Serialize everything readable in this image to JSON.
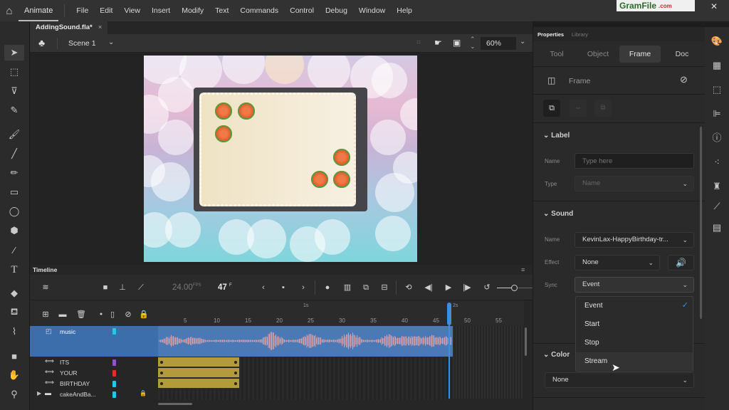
{
  "menubar": {
    "app_name": "Animate",
    "items": [
      "File",
      "Edit",
      "View",
      "Insert",
      "Modify",
      "Text",
      "Commands",
      "Control",
      "Debug",
      "Window",
      "Help"
    ],
    "watermark": "GramFile",
    "watermark_suffix": ".com"
  },
  "document": {
    "tab_label": "AddingSound.fla*",
    "close_glyph": "×",
    "scene_label": "Scene 1",
    "zoom_value": "60%"
  },
  "tools": [
    "selection",
    "subselection",
    "free-transform",
    "lasso",
    "puppet-pin",
    "paint-brush",
    "brush",
    "pencil",
    "rectangle",
    "oval",
    "polystar",
    "line",
    "text",
    "eraser",
    "paint-bucket",
    "eyedropper",
    "camera",
    "hand",
    "zoom"
  ],
  "timeline": {
    "title": "Timeline",
    "fps": "24.00",
    "fps_unit": "FPS",
    "current_frame": "47",
    "frame_unit": "F",
    "ruler_ticks": [
      "5",
      "10",
      "15",
      "20",
      "25",
      "30",
      "35",
      "40",
      "45",
      "50",
      "55"
    ],
    "ruler_seconds": [
      "1s",
      "2s"
    ],
    "layers": [
      {
        "name": "music",
        "color": "#26c6e8",
        "type": "sound",
        "selected": true
      },
      {
        "name": "ITS",
        "color": "#9a4fc9",
        "type": "motion"
      },
      {
        "name": "YOUR",
        "color": "#e0302a",
        "type": "motion"
      },
      {
        "name": "BIRTHDAY",
        "color": "#26c6e8",
        "type": "motion"
      },
      {
        "name": "cakeAndBa...",
        "color": "#26c6e8",
        "type": "folder",
        "locked": true
      }
    ]
  },
  "properties": {
    "tabs": [
      "Properties",
      "Library"
    ],
    "active_tab": "Properties",
    "subtabs": [
      "Tool",
      "Object",
      "Frame",
      "Doc"
    ],
    "active_subtab": "Frame",
    "header": "Frame",
    "label_section": {
      "title": "Label",
      "name_label": "Name",
      "name_placeholder": "Type here",
      "type_label": "Type",
      "type_value": "Name"
    },
    "sound_section": {
      "title": "Sound",
      "name_label": "Name",
      "name_value": "KevinLax-HappyBirthday-tr...",
      "effect_label": "Effect",
      "effect_value": "None",
      "sync_label": "Sync",
      "sync_value": "Event",
      "sync_options": [
        "Event",
        "Start",
        "Stop",
        "Stream"
      ],
      "sync_selected": "Event",
      "sync_hovered": "Stream"
    },
    "color_section": {
      "title": "Color",
      "value": "None"
    }
  },
  "colors": {
    "accent": "#3d8ee0",
    "music_layer": "#3b6eab",
    "tween": "#b39a3a"
  }
}
